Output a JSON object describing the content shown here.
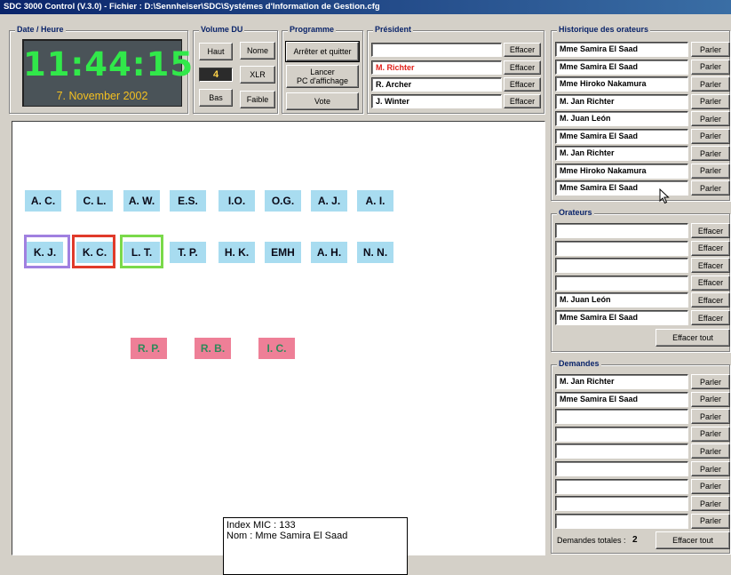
{
  "window": {
    "title": "SDC 3000 Control (V.3.0) - Fichier : D:\\Sennheiser\\SDC\\Systémes d'Information de Gestion.cfg"
  },
  "datetime": {
    "legend": "Date / Heure",
    "time": "11:44:15",
    "date": "7. November 2002"
  },
  "volume": {
    "legend": "Volume DU",
    "up_label": "Haut",
    "down_label": "Bas",
    "level": "4",
    "nominal_label": "Nome",
    "xlr_label": "XLR",
    "low_label": "Faible"
  },
  "program": {
    "legend": "Programme",
    "stop_label": "Arrêter et quitter",
    "launch_label_line1": "Lancer",
    "launch_label_line2": "PC d'affichage",
    "vote_label": "Vote"
  },
  "president": {
    "legend": "Président",
    "clear_label": "Effacer",
    "slots": [
      {
        "name": "",
        "color": "#000000"
      },
      {
        "name": "M. Richter",
        "color": "#e0201a"
      },
      {
        "name": "R. Archer",
        "color": "#000000"
      },
      {
        "name": "J. Winter",
        "color": "#000000"
      }
    ]
  },
  "seats": {
    "row1": [
      "A. C.",
      "C. L.",
      "A. W.",
      "E.S.",
      "I.O.",
      "O.G.",
      "A. J.",
      "A. I."
    ],
    "row2": [
      "K. J.",
      "K. C.",
      "L. T.",
      "T. P.",
      "H. K.",
      "EMH",
      "A. H.",
      "N. N."
    ],
    "row3": [
      "R. P.",
      "R. B.",
      "I. C."
    ],
    "highlight_colors": {
      "K. J.": "#a080e0",
      "K. C.": "#e03a2a",
      "L. T.": "#7ad94a"
    },
    "seat_color": "#a8dcf0",
    "pink_color": "#ee7f97"
  },
  "mic_info": {
    "index_line": "Index MIC : 133",
    "name_line": "Nom : Mme Samira El Saad"
  },
  "history": {
    "legend": "Historique des orateurs",
    "speak_label": "Parler",
    "items": [
      "Mme Samira El Saad",
      "Mme Samira El Saad",
      "Mme Hiroko Nakamura",
      "M. Jan Richter",
      "M. Juan León",
      "Mme Samira El Saad",
      "M. Jan Richter",
      "Mme Hiroko Nakamura",
      "Mme Samira El Saad"
    ]
  },
  "speakers": {
    "legend": "Orateurs",
    "clear_label": "Effacer",
    "clear_all_label": "Effacer tout",
    "items": [
      "",
      "",
      "",
      "",
      "M. Juan León",
      "Mme Samira El Saad"
    ]
  },
  "requests": {
    "legend": "Demandes",
    "speak_label": "Parler",
    "items": [
      "M. Jan Richter",
      "Mme Samira El Saad",
      "",
      "",
      "",
      "",
      "",
      "",
      ""
    ],
    "total_label": "Demandes totales :",
    "total_value": "2",
    "clear_all_label": "Effacer tout"
  },
  "icons": {
    "cursor": "mouse-pointer-icon"
  }
}
